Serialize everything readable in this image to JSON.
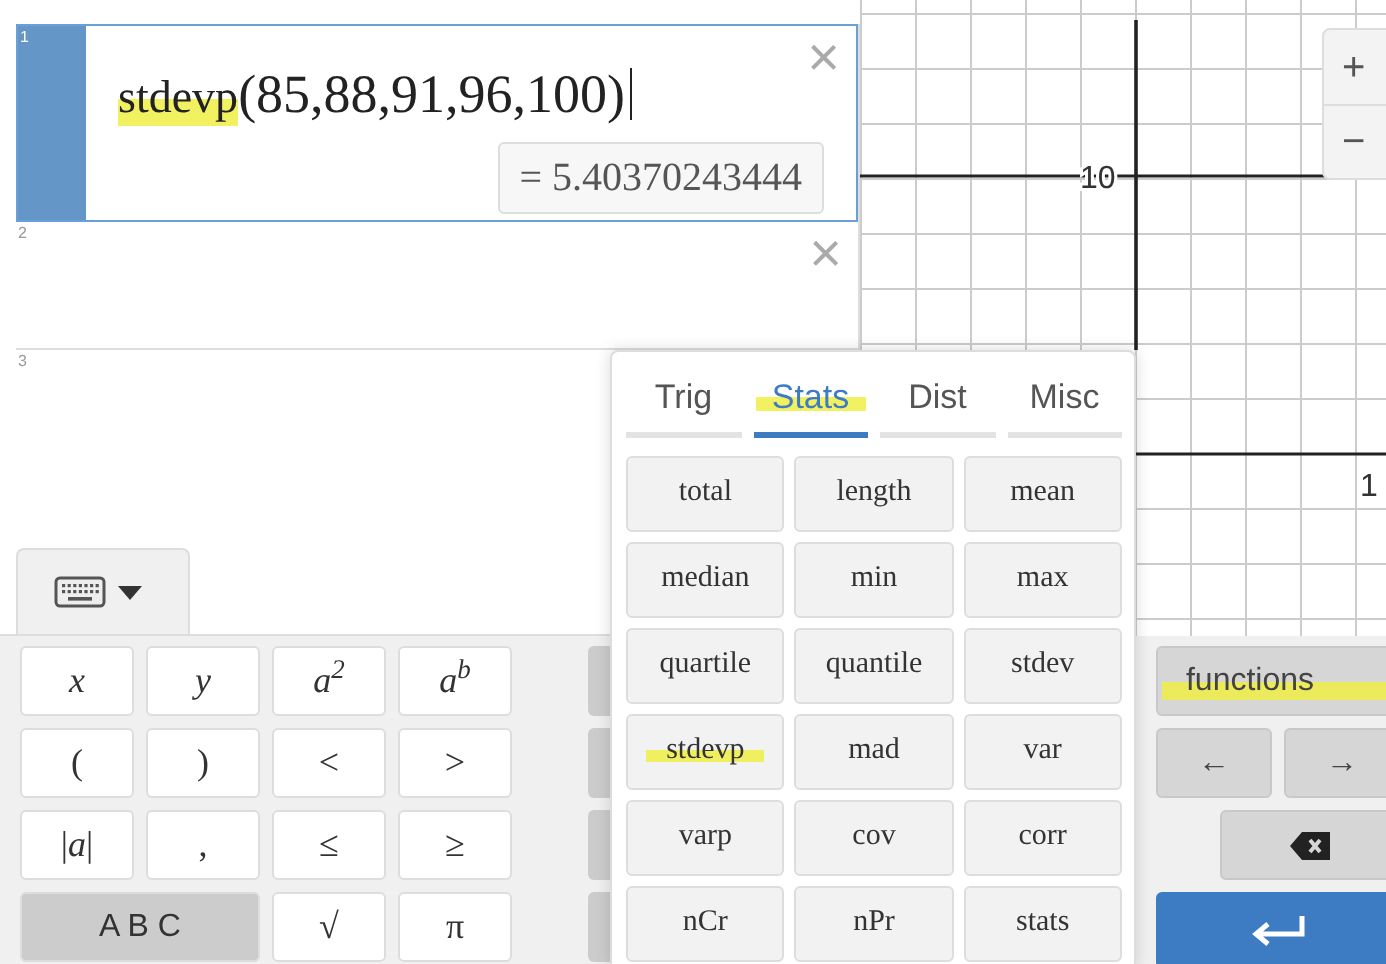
{
  "expressions": [
    {
      "number": "1",
      "selected": true,
      "function": "stdevp",
      "function_highlighted": true,
      "arguments": "(85,88,91,96,100)",
      "cursor": true,
      "result": "= 5.40370243444",
      "delete": "×"
    },
    {
      "number": "2",
      "selected": false,
      "delete": "×"
    },
    {
      "number": "3",
      "selected": false
    }
  ],
  "graph": {
    "axis_labels": [
      "10",
      "1"
    ],
    "zoom_buttons": [
      "+",
      "−"
    ]
  },
  "keypad_toggle": {
    "open": true
  },
  "keys": [
    {
      "label": "*x*",
      "kind": "math"
    },
    {
      "label": "*y*",
      "kind": "math"
    },
    {
      "label": "*a*$^{2}$",
      "kind": "math"
    },
    {
      "label": "*a*$^{b}$",
      "kind": "math"
    },
    {
      "label": "(",
      "kind": "math"
    },
    {
      "label": ")",
      "kind": "math"
    },
    {
      "label": "<",
      "kind": "math"
    },
    {
      "label": ">",
      "kind": "math"
    },
    {
      "label": "|*a*|",
      "kind": "math"
    },
    {
      "label": ",",
      "kind": "math"
    },
    {
      "label": "≤",
      "kind": "math"
    },
    {
      "label": "≥",
      "kind": "math"
    },
    {
      "label": "A B C",
      "kind": "letters"
    },
    {
      "label": "√",
      "kind": "math"
    },
    {
      "label": "π",
      "kind": "math"
    }
  ],
  "side_keys": [
    {
      "label": "functions",
      "kind": "wide",
      "highlighted": true
    },
    {
      "label": "←",
      "kind": "half"
    },
    {
      "label": "→",
      "kind": "half"
    },
    {
      "kind": "backspace"
    },
    {
      "kind": "enter"
    }
  ],
  "functions_popup": {
    "tabs": [
      {
        "label": "Trig",
        "selected": false,
        "highlighted": false
      },
      {
        "label": "Stats",
        "selected": true,
        "highlighted": true
      },
      {
        "label": "Dist",
        "selected": false,
        "highlighted": false
      },
      {
        "label": "Misc",
        "selected": false,
        "highlighted": false
      }
    ],
    "buttons": [
      {
        "label": "total",
        "highlighted": false
      },
      {
        "label": "length",
        "highlighted": false
      },
      {
        "label": "mean",
        "highlighted": false
      },
      {
        "label": "median",
        "highlighted": false
      },
      {
        "label": "min",
        "highlighted": false
      },
      {
        "label": "max",
        "highlighted": false
      },
      {
        "label": "quartile",
        "highlighted": false
      },
      {
        "label": "quantile",
        "highlighted": false
      },
      {
        "label": "stdev",
        "highlighted": false
      },
      {
        "label": "stdevp",
        "highlighted": true
      },
      {
        "label": "mad",
        "highlighted": false
      },
      {
        "label": "var",
        "highlighted": false
      },
      {
        "label": "varp",
        "highlighted": false
      },
      {
        "label": "cov",
        "highlighted": false
      },
      {
        "label": "corr",
        "highlighted": false
      },
      {
        "label": "nCr",
        "highlighted": false
      },
      {
        "label": "nPr",
        "highlighted": false
      },
      {
        "label": "stats",
        "highlighted": false
      }
    ]
  }
}
